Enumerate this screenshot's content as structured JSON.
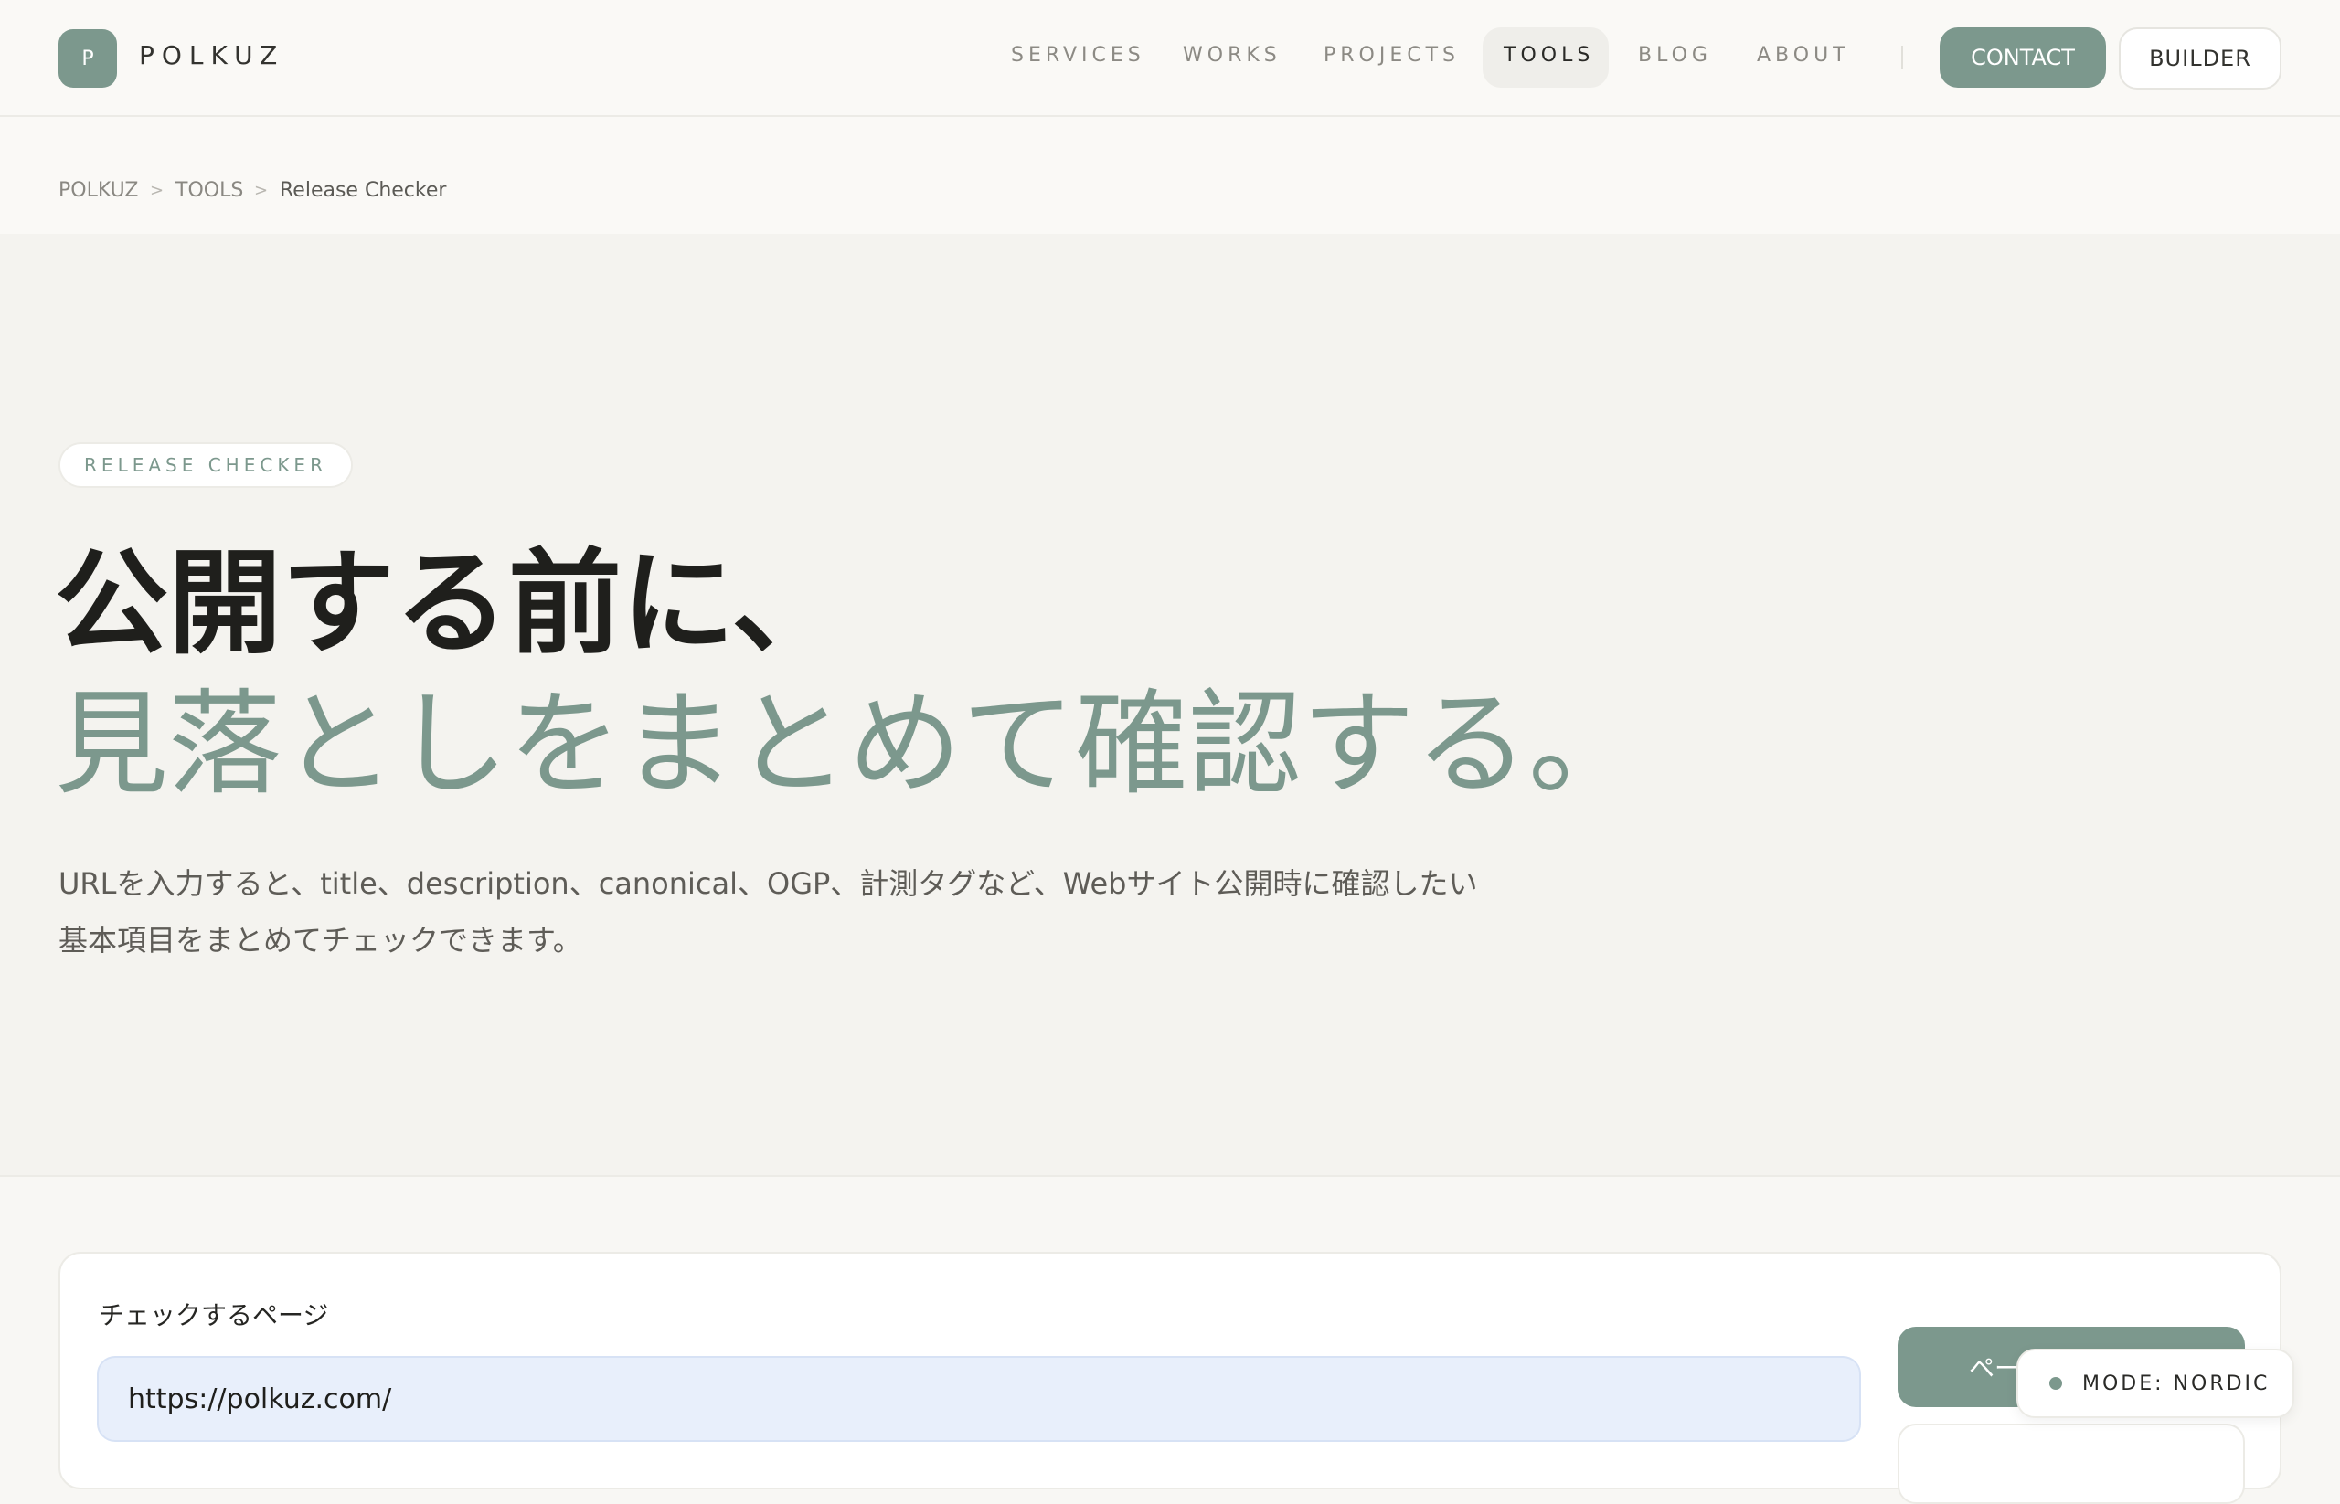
{
  "brand": {
    "mark": "P",
    "name": "POLKUZ"
  },
  "nav": {
    "items": [
      "SERVICES",
      "WORKS",
      "PROJECTS",
      "TOOLS",
      "BLOG",
      "ABOUT"
    ],
    "active": "TOOLS",
    "contact": "CONTACT",
    "builder": "BUILDER"
  },
  "breadcrumb": {
    "items": [
      "POLKUZ",
      "TOOLS",
      "Release Checker"
    ],
    "separator": ">"
  },
  "hero": {
    "badge": "RELEASE CHECKER",
    "title_line1": "公開する前に、",
    "title_line2": "見落としをまとめて確認する。",
    "description_line1": "URLを入力すると、title、description、canonical、OGP、計測タグなど、Webサイト公開時に確認したい",
    "description_line2": "基本項目をまとめてチェックできます。"
  },
  "form": {
    "label": "チェックするページ",
    "url_value": "https://polkuz.com/",
    "check_button": "ペー"
  },
  "mode_badge": "MODE: NORDIC",
  "colors": {
    "accent": "#7c988d",
    "background": "#f8f7f4",
    "input_bg": "#e8effb"
  }
}
